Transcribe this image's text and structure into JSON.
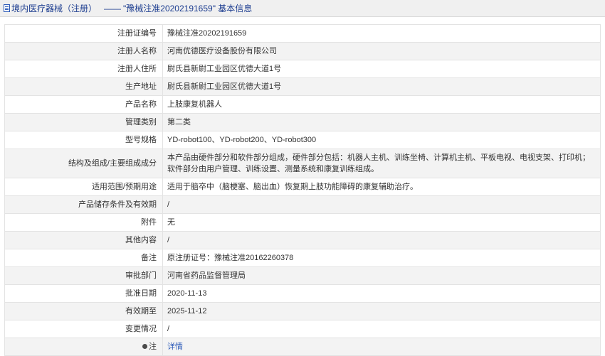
{
  "header": {
    "category": "境内医疗器械（注册）",
    "separator": "——",
    "title": "\"豫械注准20202191659\" 基本信息"
  },
  "rows": [
    {
      "label": "注册证编号",
      "value": "豫械注准20202191659"
    },
    {
      "label": "注册人名称",
      "value": "河南优德医疗设备股份有限公司"
    },
    {
      "label": "注册人住所",
      "value": "尉氏县新尉工业园区优德大道1号"
    },
    {
      "label": "生产地址",
      "value": "尉氏县新尉工业园区优德大道1号"
    },
    {
      "label": "产品名称",
      "value": "上肢康复机器人"
    },
    {
      "label": "管理类别",
      "value": "第二类"
    },
    {
      "label": "型号规格",
      "value": "YD-robot100、YD-robot200、YD-robot300"
    },
    {
      "label": "结构及组成/主要组成成分",
      "value": "本产品由硬件部分和软件部分组成，硬件部分包括：机器人主机、训练坐椅、计算机主机、平板电视、电视支架、打印机；软件部分由用户管理、训练设置、测量系统和康复训练组成。"
    },
    {
      "label": "适用范围/预期用途",
      "value": "适用于脑卒中（脑梗塞、脑出血）恢复期上肢功能障碍的康复辅助治疗。"
    },
    {
      "label": "产品储存条件及有效期",
      "value": "/"
    },
    {
      "label": "附件",
      "value": "无"
    },
    {
      "label": "其他内容",
      "value": "/"
    },
    {
      "label": "备注",
      "value": "原注册证号：豫械注准20162260378"
    },
    {
      "label": "审批部门",
      "value": "河南省药品监督管理局"
    },
    {
      "label": "批准日期",
      "value": "2020-11-13"
    },
    {
      "label": "有效期至",
      "value": "2025-11-12"
    },
    {
      "label": "变更情况",
      "value": "/"
    }
  ],
  "note_row": {
    "icon": "note-bullet-icon",
    "label": "注",
    "link": "详情"
  },
  "colors": {
    "header_text": "#1b3c8f",
    "link": "#2b59b8",
    "row_alt": "#f3f3f3",
    "border": "#e3e3e3"
  }
}
